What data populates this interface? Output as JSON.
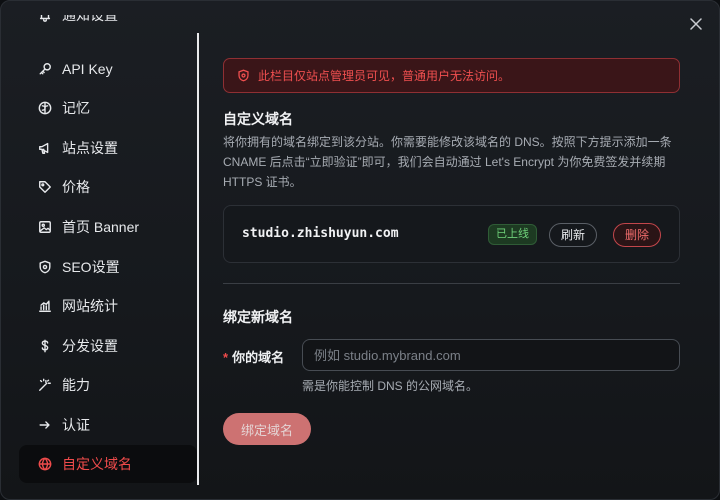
{
  "sidebar": {
    "items": [
      {
        "label": "通知设置",
        "icon": "bell-icon"
      },
      {
        "label": "API Key",
        "icon": "key-icon"
      },
      {
        "label": "记忆",
        "icon": "brain-icon"
      },
      {
        "label": "站点设置",
        "icon": "megaphone-icon"
      },
      {
        "label": "价格",
        "icon": "tag-icon"
      },
      {
        "label": "首页 Banner",
        "icon": "image-icon"
      },
      {
        "label": "SEO设置",
        "icon": "shield-icon"
      },
      {
        "label": "网站统计",
        "icon": "chart-icon"
      },
      {
        "label": "分发设置",
        "icon": "dollar-icon"
      },
      {
        "label": "能力",
        "icon": "magic-wand-icon"
      },
      {
        "label": "认证",
        "icon": "arrow-right-icon"
      },
      {
        "label": "自定义域名",
        "icon": "globe-icon",
        "active": true
      }
    ]
  },
  "alert": {
    "text": "此栏目仅站点管理员可见，普通用户无法访问。",
    "icon": "shield-alert-icon"
  },
  "custom_domain": {
    "title": "自定义域名",
    "description": "将你拥有的域名绑定到该分站。你需要能修改该域名的 DNS。按照下方提示添加一条 CNAME 后点击“立即验证”即可，我们会自动通过 Let's Encrypt 为你免费签发并续期 HTTPS 证书。",
    "domain": "studio.zhishuyun.com",
    "status": "已上线",
    "refresh_label": "刷新",
    "delete_label": "删除"
  },
  "bind_new": {
    "title": "绑定新域名",
    "field_label": "你的域名",
    "placeholder": "例如 studio.mybrand.com",
    "value": "",
    "hint": "需是你能控制 DNS 的公网域名。",
    "submit_label": "绑定域名"
  },
  "colors": {
    "accent": "#ef4b4b",
    "online": "#6fd17a",
    "background": "#16191d"
  }
}
